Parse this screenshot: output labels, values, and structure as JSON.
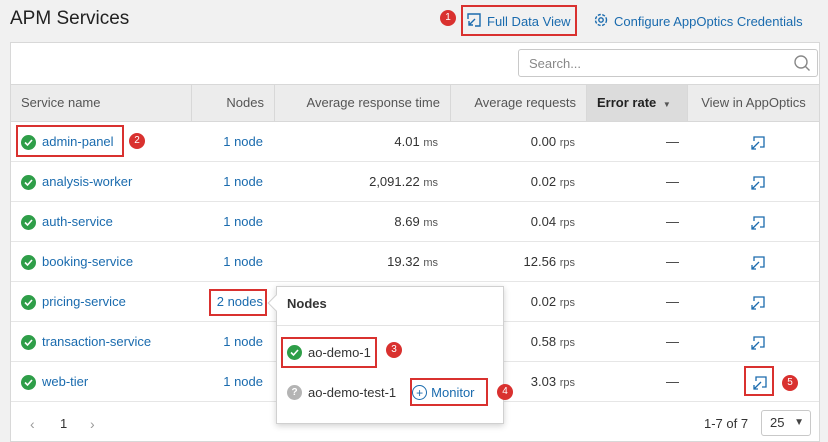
{
  "header": {
    "title": "APM Services",
    "full_data_view": "Full Data View",
    "configure": "Configure AppOptics Credentials"
  },
  "search": {
    "placeholder": "Search..."
  },
  "columns": [
    "Service name",
    "Nodes",
    "Average response time",
    "Average requests",
    "Error rate",
    "View in AppOptics"
  ],
  "rows": [
    {
      "name": "admin-panel",
      "nodes": "1 node",
      "resp": "4.01",
      "resp_unit": "ms",
      "req": "0.00",
      "req_unit": "rps",
      "err": "—"
    },
    {
      "name": "analysis-worker",
      "nodes": "1 node",
      "resp": "2,091.22",
      "resp_unit": "ms",
      "req": "0.02",
      "req_unit": "rps",
      "err": "—"
    },
    {
      "name": "auth-service",
      "nodes": "1 node",
      "resp": "8.69",
      "resp_unit": "ms",
      "req": "0.04",
      "req_unit": "rps",
      "err": "—"
    },
    {
      "name": "booking-service",
      "nodes": "1 node",
      "resp": "19.32",
      "resp_unit": "ms",
      "req": "12.56",
      "req_unit": "rps",
      "err": "—"
    },
    {
      "name": "pricing-service",
      "nodes": "2 nodes",
      "resp": "",
      "resp_unit": "",
      "req": "0.02",
      "req_unit": "rps",
      "err": "—"
    },
    {
      "name": "transaction-service",
      "nodes": "1 node",
      "resp": "",
      "resp_unit": "",
      "req": "0.58",
      "req_unit": "rps",
      "err": "—"
    },
    {
      "name": "web-tier",
      "nodes": "1 node",
      "resp": "",
      "resp_unit": "",
      "req": "3.03",
      "req_unit": "rps",
      "err": "—"
    }
  ],
  "popover": {
    "title": "Nodes",
    "node1": "ao-demo-1",
    "node2": "ao-demo-test-1",
    "monitor": "Monitor"
  },
  "pagination": {
    "page": "1",
    "range": "1-7 of 7",
    "page_size": "25"
  },
  "callouts": [
    "1",
    "2",
    "3",
    "4",
    "5"
  ],
  "colors": {
    "link": "#1a6bae",
    "ok": "#2e9e48",
    "callout": "#d9312f"
  }
}
